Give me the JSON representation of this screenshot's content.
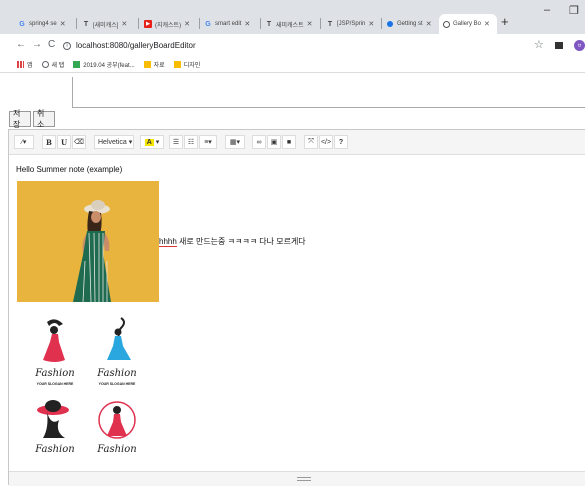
{
  "browser": {
    "tabs": [
      {
        "label": "spring4 se",
        "icon": "google-icon"
      },
      {
        "label": "[새미캐스]",
        "icon": "tistory-icon"
      },
      {
        "label": "(지캐스트)",
        "icon": "youtube-icon"
      },
      {
        "label": "smart edit",
        "icon": "google-icon"
      },
      {
        "label": "새미캐스트",
        "icon": "tistory-icon"
      },
      {
        "label": "[JSP/Sprin",
        "icon": "tistory-icon"
      },
      {
        "label": "Getting st",
        "icon": "blue-dot-icon"
      },
      {
        "label": "Gallery Bo",
        "icon": "globe-icon",
        "active": true
      }
    ],
    "new_tab": "+",
    "minimize": "–",
    "restore": "❐",
    "back": "←",
    "forward": "→",
    "reload": "C",
    "url": "localhost:8080/galleryBoardEditor",
    "bookmarks": [
      {
        "label": "앱",
        "color": "#4285f4"
      },
      {
        "label": "새 탭",
        "color": "#5f6368"
      },
      {
        "label": "2019.04 공부(feat...",
        "color": "#34a853"
      },
      {
        "label": "자료",
        "color": "#fbbc04"
      },
      {
        "label": "디자인",
        "color": "#fbbc04"
      }
    ],
    "profile_initial": "ㅂ"
  },
  "form": {
    "save_label": "저장",
    "cancel_label": "취소"
  },
  "toolbar": {
    "font_name": "Helvetica",
    "style_icon": "magic-wand-icon",
    "bold": "B",
    "underline": "U",
    "eraser_icon": "eraser-icon",
    "font_color_label": "A",
    "help": "?",
    "code": "</>"
  },
  "content": {
    "heading": "Hello Summer note (example)",
    "inline_prefix": "hhhh",
    "inline_text": " 새로 만드는중 ㅋㅋㅋㅋ 다나 모르게다",
    "logos": [
      {
        "word": "Fashion",
        "slogan": "YOUR SLOGAN HERE",
        "accent": "#e0314f"
      },
      {
        "word": "Fashion",
        "slogan": "YOUR SLOGAN HERE",
        "accent": "#2aa7df"
      },
      {
        "word": "Fashion",
        "slogan": "",
        "accent": "#e0314f"
      },
      {
        "word": "Fashion",
        "slogan": "",
        "accent": "#e0314f"
      }
    ]
  },
  "colors": {
    "tabbar": "#dee1e6",
    "photo_background": "#e9b43d",
    "dress": "#1f6b4f",
    "font_color_swatch": "#f5e500"
  }
}
